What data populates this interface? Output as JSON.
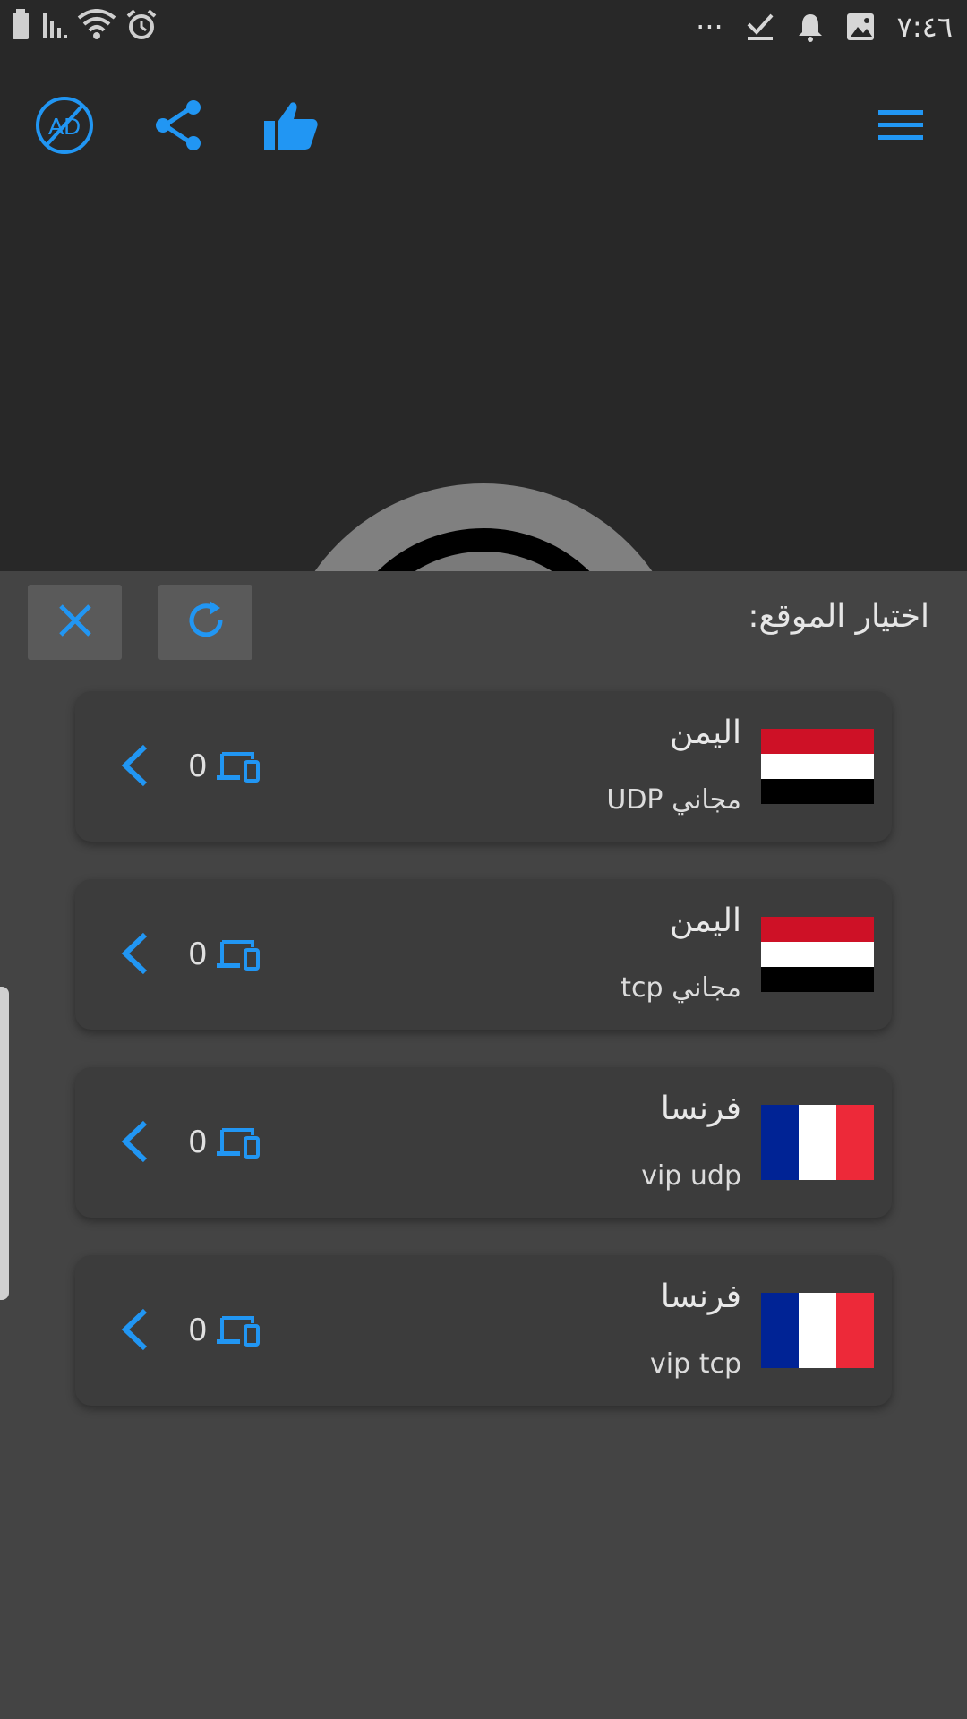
{
  "status_bar": {
    "time": "٧:٤٦",
    "overflow": "···"
  },
  "app_bar": {
    "icons": [
      "remove-ads-icon",
      "share-icon",
      "thumbs-up-icon",
      "menu-icon"
    ],
    "accent_color": "#2196f3"
  },
  "location_sheet": {
    "title": "اختيار الموقع:",
    "close_icon": "close-icon",
    "refresh_icon": "refresh-icon",
    "servers": [
      {
        "country": "اليمن",
        "protocol": "مجاني UDP",
        "flag": "yemen",
        "device_count": "0"
      },
      {
        "country": "اليمن",
        "protocol": "مجاني tcp",
        "flag": "yemen",
        "device_count": "0"
      },
      {
        "country": "فرنسا",
        "protocol": "vip udp",
        "flag": "france",
        "device_count": "0"
      },
      {
        "country": "فرنسا",
        "protocol": "vip tcp",
        "flag": "france",
        "device_count": "0"
      }
    ]
  },
  "colors": {
    "background": "#282828",
    "sheet": "#444444",
    "card": "#3c3c3c",
    "accent": "#2196f3"
  }
}
